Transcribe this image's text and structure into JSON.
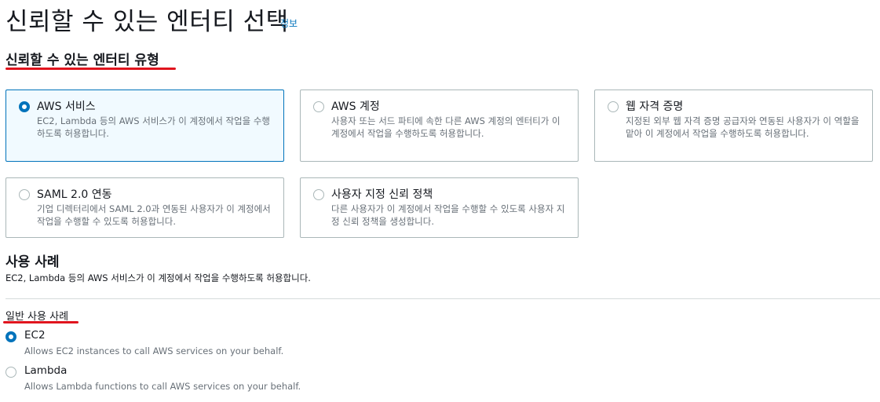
{
  "header": {
    "title": "신뢰할 수 있는 엔터티 선택",
    "info_link": "정보"
  },
  "trusted_entity_type": {
    "title": "신뢰할 수 있는 엔터티 유형",
    "selected": "aws-service",
    "options": [
      {
        "id": "aws-service",
        "label": "AWS 서비스",
        "description": "EC2, Lambda 등의 AWS 서비스가 이 계정에서 작업을 수행하도록 허용합니다."
      },
      {
        "id": "aws-account",
        "label": "AWS 계정",
        "description": "사용자 또는 서드 파티에 속한 다른 AWS 계정의 엔터티가 이 계정에서 작업을 수행하도록 허용합니다."
      },
      {
        "id": "web-identity",
        "label": "웹 자격 증명",
        "description": "지정된 외부 웹 자격 증명 공급자와 연동된 사용자가 이 역할을 맡아 이 계정에서 작업을 수행하도록 허용합니다."
      },
      {
        "id": "saml",
        "label": "SAML 2.0 연동",
        "description": "기업 디렉터리에서 SAML 2.0과 연동된 사용자가 이 계정에서 작업을 수행할 수 있도록 허용합니다."
      },
      {
        "id": "custom-trust-policy",
        "label": "사용자 지정 신뢰 정책",
        "description": "다른 사용자가 이 계정에서 작업을 수행할 수 있도록 사용자 지정 신뢰 정책을 생성합니다."
      }
    ]
  },
  "use_case": {
    "title": "사용 사례",
    "description": "EC2, Lambda 등의 AWS 서비스가 이 계정에서 작업을 수행하도록 허용합니다.",
    "common_label": "일반 사용 사례",
    "selected": "ec2",
    "options": [
      {
        "id": "ec2",
        "label": "EC2",
        "description": "Allows EC2 instances to call AWS services on your behalf."
      },
      {
        "id": "lambda",
        "label": "Lambda",
        "description": "Allows Lambda functions to call AWS services on your behalf."
      }
    ]
  },
  "colors": {
    "accent": "#0073bb",
    "selected_tile_bg": "#f1faff",
    "annotation_underline": "#e0141e"
  }
}
